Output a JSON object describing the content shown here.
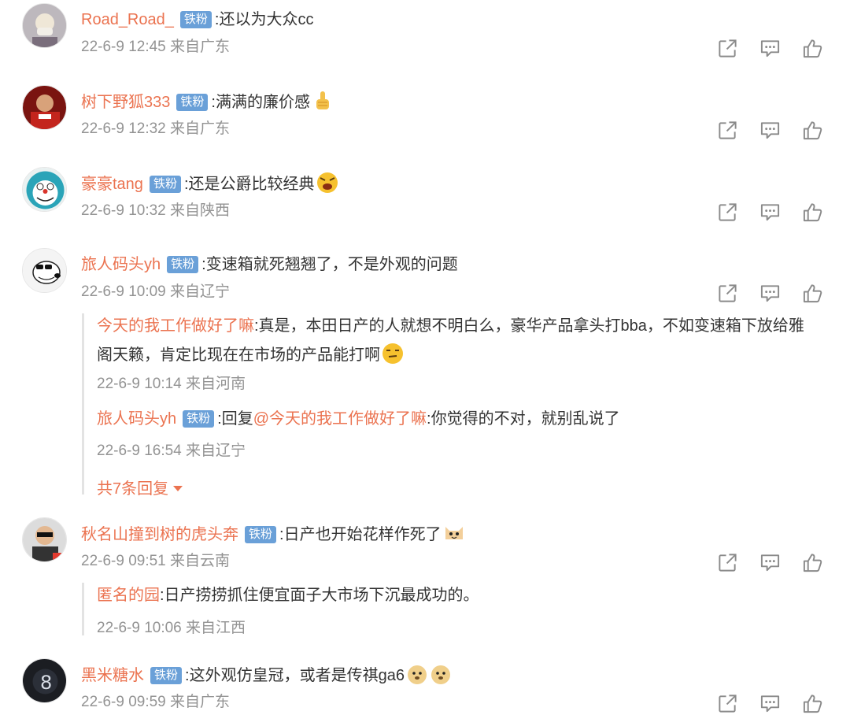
{
  "badge_label": "铁粉",
  "comments": [
    {
      "user": "Road_Road_",
      "text": ":还以为大众cc",
      "time": "22-6-9 12:45",
      "location": "来自广东"
    },
    {
      "user": "树下野狐333",
      "text": ":满满的廉价感",
      "time": "22-6-9 12:32",
      "location": "来自广东",
      "emoji": "thumbs-up-emoji"
    },
    {
      "user": "豪豪tang",
      "text": ":还是公爵比较经典",
      "time": "22-6-9 10:32",
      "location": "来自陕西",
      "emoji": "angry-emoji"
    },
    {
      "user": "旅人码头yh",
      "text": ":变速箱就死翘翘了，不是外观的问题",
      "time": "22-6-9 10:09",
      "location": "来自辽宁"
    },
    {
      "user": "秋名山撞到树的虎头奔",
      "text": ":日产也开始花样作死了",
      "time": "22-6-9 09:51",
      "location": "来自云南",
      "emoji": "cat-emoji"
    },
    {
      "user": "黑米糖水",
      "text": ":这外观仿皇冠，或者是传祺ga6",
      "time": "22-6-9 09:59",
      "location": "来自广东",
      "emoji": "doge-emoji"
    }
  ],
  "replies_1": [
    {
      "user": "今天的我工作做好了嘛",
      "text_a": ":真是，本田日产的人就想不明白么，豪华产品拿头打bba，不如变速箱下放给雅",
      "text_b": "阁天籁，肯定比现在在市场的产品能打啊",
      "time": "22-6-9 10:14",
      "location": "来自河南",
      "emoji": "smirk-emoji"
    },
    {
      "user": "旅人码头yh",
      "reply_prefix": ":回复",
      "mention": "@今天的我工作做好了嘛",
      "text": ":你觉得的不对，就别乱说了",
      "time": "22-6-9 16:54",
      "location": "来自辽宁"
    }
  ],
  "more_replies": "共7条回复",
  "replies_2": [
    {
      "user": "匿名的园",
      "text": ":日产捞捞抓住便宜面子大市场下沉最成功的。",
      "time": "22-6-9 10:06",
      "location": "来自江西"
    }
  ],
  "colors": {
    "username": "#eb7350",
    "badge": "#6aa0d8",
    "meta": "#939393",
    "icon": "#8a8a8a"
  }
}
